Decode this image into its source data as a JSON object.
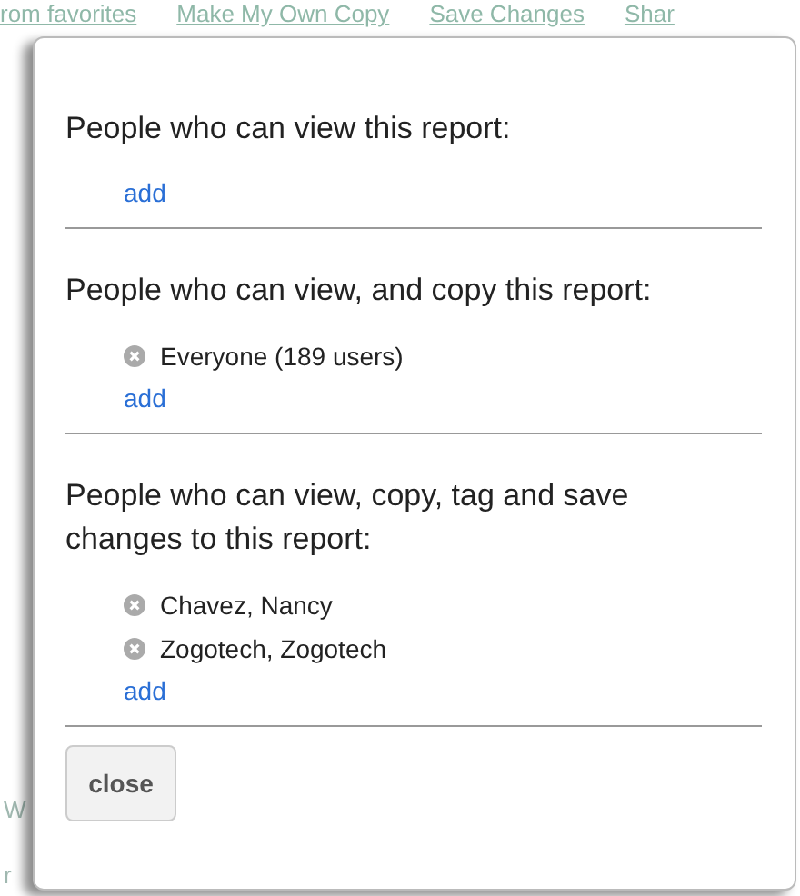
{
  "background_links": [
    "rom favorites",
    "Make My Own Copy",
    "Save Changes",
    "Shar"
  ],
  "background_fragments": [
    "W",
    "r"
  ],
  "sections": [
    {
      "heading": "People who can view this report:",
      "add_label": "add"
    },
    {
      "heading": "People who can view, and copy this report:",
      "members": [
        "Everyone (189 users)"
      ],
      "add_label": "add"
    },
    {
      "heading": "People who can view, copy, tag and save changes to this report:",
      "members": [
        "Chavez, Nancy",
        "Zogotech, Zogotech"
      ],
      "add_label": "add"
    }
  ],
  "close_button": "close"
}
